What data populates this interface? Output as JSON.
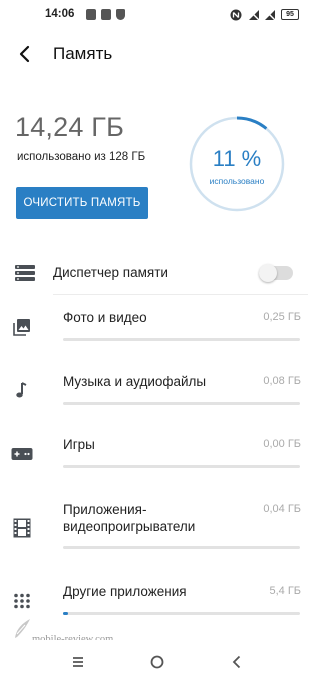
{
  "status_bar": {
    "time": "14:06",
    "battery": "95",
    "left_icons": [
      "notification-icon",
      "notification-icon",
      "shield-icon"
    ],
    "right_icons": [
      "nfc-icon",
      "no-signal-icon",
      "no-signal-icon"
    ]
  },
  "header": {
    "title": "Память",
    "back_icon": "arrow-back-icon"
  },
  "usage": {
    "used": "14,24 ГБ",
    "used_of": "использовано из 128 ГБ",
    "percent": "11 %",
    "percent_value": 11,
    "percent_caption": "использовано",
    "clean_button": "ОЧИСТИТЬ ПАМЯТЬ"
  },
  "memory_manager": {
    "label": "Диспетчер памяти",
    "enabled": false
  },
  "categories": [
    {
      "label": "Фото и видео",
      "size": "0,25 ГБ",
      "fraction": 0,
      "icon": "image-icon"
    },
    {
      "label": "Музыка и аудиофайлы",
      "size": "0,08 ГБ",
      "fraction": 0,
      "icon": "music-note-icon"
    },
    {
      "label": "Игры",
      "size": "0,00 ГБ",
      "fraction": 0,
      "icon": "gamepad-icon"
    },
    {
      "label": "Приложения-видеопроигрыватели",
      "size": "0,04 ГБ",
      "fraction": 0,
      "icon": "film-icon"
    },
    {
      "label": "Другие приложения",
      "size": "5,4 ГБ",
      "fraction": 0.02,
      "icon": "apps-grid-icon"
    }
  ],
  "watermark": "mobile-review.com",
  "colors": {
    "accent": "#2a7fc4",
    "gauge_track": "#cfe1ef",
    "secondary_text": "#aaaaaa"
  },
  "navbar": {
    "icons": [
      "menu-icon",
      "home-circle-icon",
      "back-chevron-icon"
    ]
  }
}
